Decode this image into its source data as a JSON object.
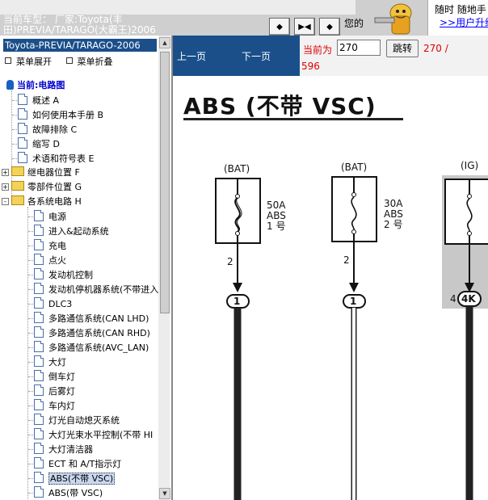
{
  "header": {
    "car_line1": "当前车型：  厂家:Toyota(丰",
    "car_line2": "田)PREVIA/TARAGO(大霸王)2006",
    "nav_buttons": [
      "◆",
      "▶◀",
      "◆"
    ],
    "welcome": "您的",
    "promo_line1": "随时 随地手",
    "promo_link": ">>用户升级"
  },
  "sidebar": {
    "title": "Toyota-PREVIA/TARAGO-2006",
    "expand_label": "菜单展开",
    "collapse_label": "菜单折叠",
    "root_label": "当前:电路图",
    "items": [
      {
        "label": "概述 A",
        "type": "doc"
      },
      {
        "label": "如何使用本手册 B",
        "type": "doc"
      },
      {
        "label": "故障排除 C",
        "type": "doc"
      },
      {
        "label": "缩写 D",
        "type": "doc"
      },
      {
        "label": "术语和符号表 E",
        "type": "doc"
      },
      {
        "label": "继电器位置 F",
        "type": "folder",
        "toggle": "+"
      },
      {
        "label": "零部件位置 G",
        "type": "folder",
        "toggle": "+"
      },
      {
        "label": "各系统电路 H",
        "type": "folder",
        "toggle": "-"
      }
    ],
    "subitems": [
      "电源",
      "进入&起动系统",
      "充电",
      "点火",
      "发动机控制",
      "发动机停机器系统(不带进入",
      "DLC3",
      "多路通信系统(CAN LHD)",
      "多路通信系统(CAN RHD)",
      "多路通信系统(AVC_LAN)",
      "大灯",
      "倒车灯",
      "后雾灯",
      "车内灯",
      "灯光自动熄灭系统",
      "大灯光束水平控制(不带 HI",
      "大灯清洁器",
      "ECT 和 A/T指示灯",
      "ABS(不带 VSC)",
      "ABS(带 VSC)"
    ],
    "selected_index": 18
  },
  "pager": {
    "prev_label": "上一页",
    "next_label": "下一页",
    "current_label": "当前为",
    "page_value": "270",
    "go_label": "跳转",
    "count_a": "270 /",
    "count_b": "596"
  },
  "diagram": {
    "title": "ABS (不带 VSC)",
    "fuses": [
      {
        "source": "(BAT)",
        "rating": "50A",
        "name": "ABS",
        "num": "1 号",
        "pin": "2",
        "connector": "1"
      },
      {
        "source": "(BAT)",
        "rating": "30A",
        "name": "ABS",
        "num": "2 号",
        "pin": "2",
        "connector": "1"
      },
      {
        "source": "(IG)",
        "rating": "",
        "name": "",
        "num": "",
        "pin": "4",
        "connector": "4K"
      }
    ]
  }
}
